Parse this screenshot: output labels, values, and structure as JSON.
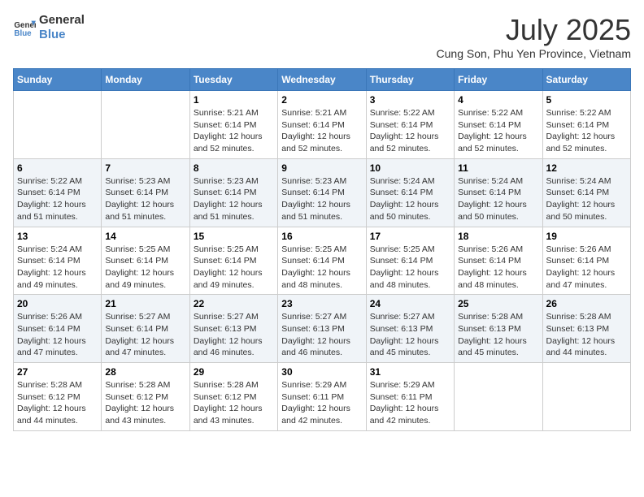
{
  "logo": {
    "line1": "General",
    "line2": "Blue"
  },
  "title": "July 2025",
  "location": "Cung Son, Phu Yen Province, Vietnam",
  "days_of_week": [
    "Sunday",
    "Monday",
    "Tuesday",
    "Wednesday",
    "Thursday",
    "Friday",
    "Saturday"
  ],
  "weeks": [
    [
      {
        "day": "",
        "info": ""
      },
      {
        "day": "",
        "info": ""
      },
      {
        "day": "1",
        "sunrise": "5:21 AM",
        "sunset": "6:14 PM",
        "daylight": "12 hours and 52 minutes."
      },
      {
        "day": "2",
        "sunrise": "5:21 AM",
        "sunset": "6:14 PM",
        "daylight": "12 hours and 52 minutes."
      },
      {
        "day": "3",
        "sunrise": "5:22 AM",
        "sunset": "6:14 PM",
        "daylight": "12 hours and 52 minutes."
      },
      {
        "day": "4",
        "sunrise": "5:22 AM",
        "sunset": "6:14 PM",
        "daylight": "12 hours and 52 minutes."
      },
      {
        "day": "5",
        "sunrise": "5:22 AM",
        "sunset": "6:14 PM",
        "daylight": "12 hours and 52 minutes."
      }
    ],
    [
      {
        "day": "6",
        "sunrise": "5:22 AM",
        "sunset": "6:14 PM",
        "daylight": "12 hours and 51 minutes."
      },
      {
        "day": "7",
        "sunrise": "5:23 AM",
        "sunset": "6:14 PM",
        "daylight": "12 hours and 51 minutes."
      },
      {
        "day": "8",
        "sunrise": "5:23 AM",
        "sunset": "6:14 PM",
        "daylight": "12 hours and 51 minutes."
      },
      {
        "day": "9",
        "sunrise": "5:23 AM",
        "sunset": "6:14 PM",
        "daylight": "12 hours and 51 minutes."
      },
      {
        "day": "10",
        "sunrise": "5:24 AM",
        "sunset": "6:14 PM",
        "daylight": "12 hours and 50 minutes."
      },
      {
        "day": "11",
        "sunrise": "5:24 AM",
        "sunset": "6:14 PM",
        "daylight": "12 hours and 50 minutes."
      },
      {
        "day": "12",
        "sunrise": "5:24 AM",
        "sunset": "6:14 PM",
        "daylight": "12 hours and 50 minutes."
      }
    ],
    [
      {
        "day": "13",
        "sunrise": "5:24 AM",
        "sunset": "6:14 PM",
        "daylight": "12 hours and 49 minutes."
      },
      {
        "day": "14",
        "sunrise": "5:25 AM",
        "sunset": "6:14 PM",
        "daylight": "12 hours and 49 minutes."
      },
      {
        "day": "15",
        "sunrise": "5:25 AM",
        "sunset": "6:14 PM",
        "daylight": "12 hours and 49 minutes."
      },
      {
        "day": "16",
        "sunrise": "5:25 AM",
        "sunset": "6:14 PM",
        "daylight": "12 hours and 48 minutes."
      },
      {
        "day": "17",
        "sunrise": "5:25 AM",
        "sunset": "6:14 PM",
        "daylight": "12 hours and 48 minutes."
      },
      {
        "day": "18",
        "sunrise": "5:26 AM",
        "sunset": "6:14 PM",
        "daylight": "12 hours and 48 minutes."
      },
      {
        "day": "19",
        "sunrise": "5:26 AM",
        "sunset": "6:14 PM",
        "daylight": "12 hours and 47 minutes."
      }
    ],
    [
      {
        "day": "20",
        "sunrise": "5:26 AM",
        "sunset": "6:14 PM",
        "daylight": "12 hours and 47 minutes."
      },
      {
        "day": "21",
        "sunrise": "5:27 AM",
        "sunset": "6:14 PM",
        "daylight": "12 hours and 47 minutes."
      },
      {
        "day": "22",
        "sunrise": "5:27 AM",
        "sunset": "6:13 PM",
        "daylight": "12 hours and 46 minutes."
      },
      {
        "day": "23",
        "sunrise": "5:27 AM",
        "sunset": "6:13 PM",
        "daylight": "12 hours and 46 minutes."
      },
      {
        "day": "24",
        "sunrise": "5:27 AM",
        "sunset": "6:13 PM",
        "daylight": "12 hours and 45 minutes."
      },
      {
        "day": "25",
        "sunrise": "5:28 AM",
        "sunset": "6:13 PM",
        "daylight": "12 hours and 45 minutes."
      },
      {
        "day": "26",
        "sunrise": "5:28 AM",
        "sunset": "6:13 PM",
        "daylight": "12 hours and 44 minutes."
      }
    ],
    [
      {
        "day": "27",
        "sunrise": "5:28 AM",
        "sunset": "6:12 PM",
        "daylight": "12 hours and 44 minutes."
      },
      {
        "day": "28",
        "sunrise": "5:28 AM",
        "sunset": "6:12 PM",
        "daylight": "12 hours and 43 minutes."
      },
      {
        "day": "29",
        "sunrise": "5:28 AM",
        "sunset": "6:12 PM",
        "daylight": "12 hours and 43 minutes."
      },
      {
        "day": "30",
        "sunrise": "5:29 AM",
        "sunset": "6:11 PM",
        "daylight": "12 hours and 42 minutes."
      },
      {
        "day": "31",
        "sunrise": "5:29 AM",
        "sunset": "6:11 PM",
        "daylight": "12 hours and 42 minutes."
      },
      {
        "day": "",
        "info": ""
      },
      {
        "day": "",
        "info": ""
      }
    ]
  ]
}
